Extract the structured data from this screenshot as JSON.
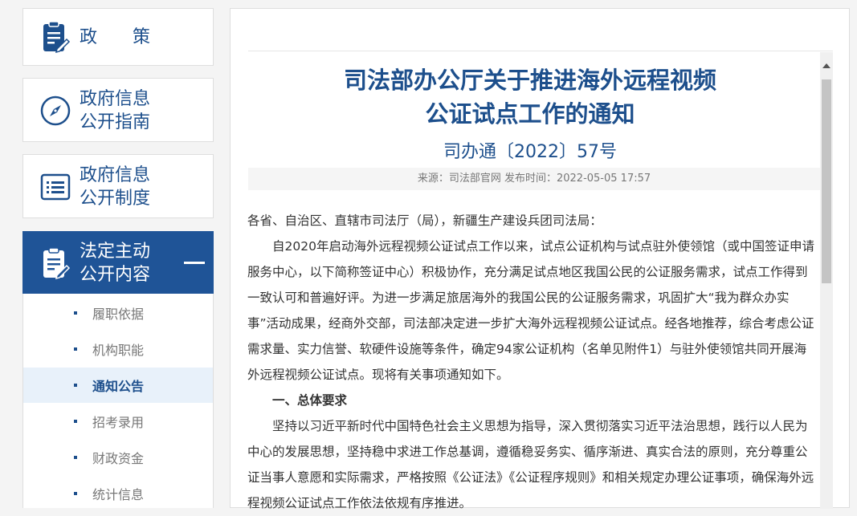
{
  "sidebar": {
    "nav": [
      {
        "label": "政　　策"
      },
      {
        "label_line1": "政府信息",
        "label_line2": "公开指南"
      },
      {
        "label_line1": "政府信息",
        "label_line2": "公开制度"
      },
      {
        "label_line1": "法定主动",
        "label_line2": "公开内容"
      }
    ],
    "subitems": [
      "履职依据",
      "机构职能",
      "通知公告",
      "招考录用",
      "财政资金",
      "统计信息"
    ]
  },
  "article": {
    "title_line1": "司法部办公厅关于推进海外远程视频",
    "title_line2": "公证试点工作的通知",
    "doc_number": "司办通〔2022〕57号",
    "meta": "来源：司法部官网 发布时间：2022-05-05 17:57",
    "greeting": "各省、自治区、直辖市司法厅（局），新疆生产建设兵团司法局：",
    "para1": "自2020年启动海外远程视频公证试点工作以来，试点公证机构与试点驻外使领馆（或中国签证申请服务中心，以下简称签证中心）积极协作，充分满足试点地区我国公民的公证服务需求，试点工作得到一致认可和普遍好评。为进一步满足旅居海外的我国公民的公证服务需求，巩固扩大“我为群众办实事”活动成果，经商外交部，司法部决定进一步扩大海外远程视频公证试点。经各地推荐，综合考虑公证需求量、实力信誉、软硬件设施等条件，确定94家公证机构（名单见附件1）与驻外使领馆共同开展海外远程视频公证试点。现将有关事项通知如下。",
    "heading1": "一、总体要求",
    "para2": "坚持以习近平新时代中国特色社会主义思想为指导，深入贯彻落实习近平法治思想，践行以人民为中心的发展思想，坚持稳中求进工作总基调，遵循稳妥务实、循序渐进、真实合法的原则，充分尊重公证当事人意愿和实际需求，严格按照《公证法》《公证程序规则》和相关规定办理公证事项，确保海外远程视频公证试点工作依法依规有序推进。"
  },
  "colors": {
    "brand": "#1d4f8c",
    "active_nav": "#1f5497",
    "active_sub_bg": "#e8f1fa"
  },
  "icons": [
    "clipboard-pen-icon",
    "compass-icon",
    "list-document-icon",
    "clipboard-pen-icon",
    "minus-icon",
    "scroll-up-arrow-icon"
  ]
}
